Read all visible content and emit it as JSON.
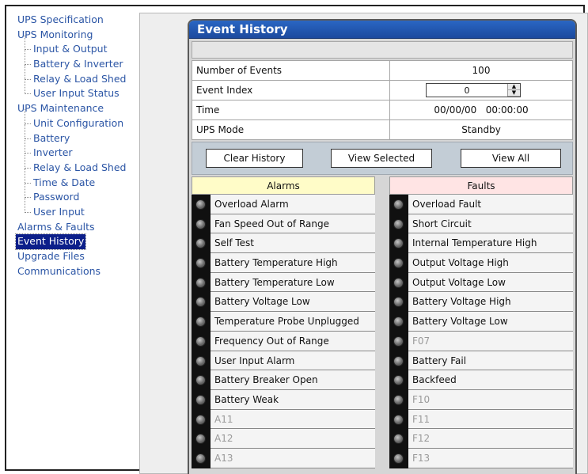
{
  "sidebar": {
    "items": [
      {
        "label": "UPS Specification"
      },
      {
        "label": "UPS Monitoring"
      },
      {
        "label": "Input & Output"
      },
      {
        "label": "Battery & Inverter"
      },
      {
        "label": "Relay & Load Shed"
      },
      {
        "label": "User Input Status"
      },
      {
        "label": "UPS Maintenance"
      },
      {
        "label": "Unit Configuration"
      },
      {
        "label": "Battery"
      },
      {
        "label": "Inverter"
      },
      {
        "label": "Relay & Load Shed"
      },
      {
        "label": "Time & Date"
      },
      {
        "label": "Password"
      },
      {
        "label": "User Input"
      },
      {
        "label": "Alarms & Faults"
      },
      {
        "label": "Event History"
      },
      {
        "label": "Upgrade Files"
      },
      {
        "label": "Communications"
      }
    ]
  },
  "panel": {
    "title": "Event History",
    "rows": {
      "num_events": {
        "label": "Number of Events",
        "value": "100"
      },
      "event_index": {
        "label": "Event Index",
        "value": "0"
      },
      "time": {
        "label": "Time",
        "value": "00/00/00   00:00:00"
      },
      "ups_mode": {
        "label": "UPS Mode",
        "value": "Standby"
      }
    },
    "buttons": {
      "clear": "Clear History",
      "view_selected": "View Selected",
      "view_all": "View All"
    },
    "alarms": {
      "header": "Alarms",
      "items": [
        "Overload Alarm",
        "Fan Speed Out of Range",
        "Self Test",
        "Battery Temperature High",
        "Battery Temperature Low",
        "Battery Voltage Low",
        "Temperature Probe Unplugged",
        "Frequency Out of Range",
        "User Input Alarm",
        "Battery Breaker Open",
        "Battery Weak",
        "A11",
        "A12",
        "A13"
      ]
    },
    "faults": {
      "header": "Faults",
      "items": [
        "Overload Fault",
        "Short Circuit",
        "Internal Temperature High",
        "Output Voltage High",
        "Output Voltage Low",
        "Battery Voltage High",
        "Battery Voltage Low",
        "F07",
        "Battery Fail",
        "Backfeed",
        "F10",
        "F11",
        "F12",
        "F13"
      ]
    }
  },
  "colors": {
    "title_bar": "#1f52a8",
    "nav_link": "#2b55a5",
    "nav_selected": "#0c1f8a",
    "alarms_header": "#fffcc8",
    "faults_header": "#ffe4e4"
  }
}
